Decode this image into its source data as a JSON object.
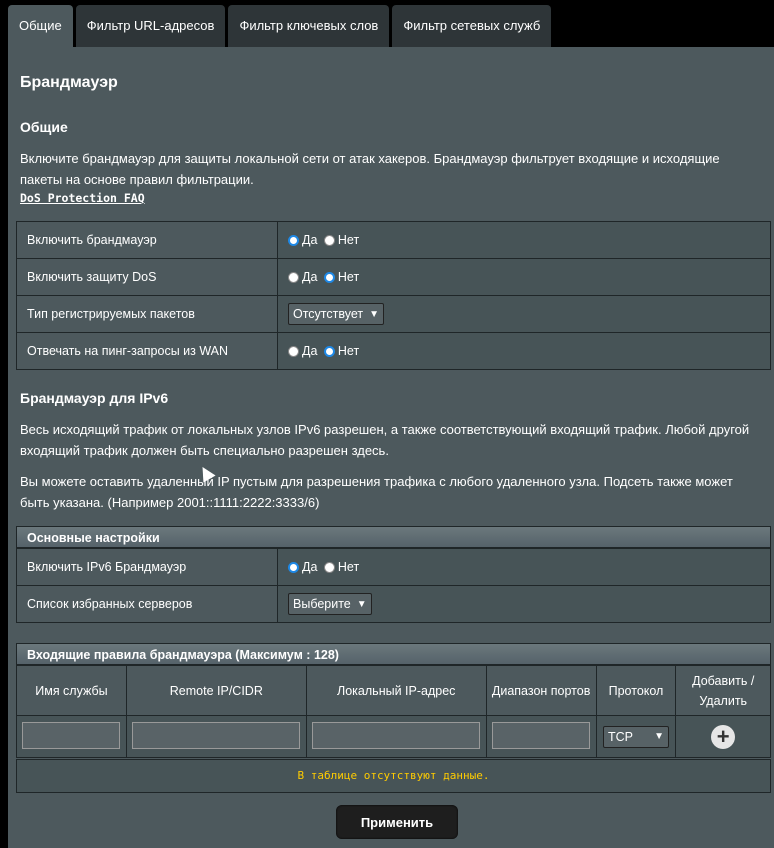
{
  "tabs": [
    "Общие",
    "Фильтр URL-адресов",
    "Фильтр ключевых слов",
    "Фильтр сетевых служб"
  ],
  "header": {
    "title": "Брандмауэр"
  },
  "general": {
    "title": "Общие",
    "description": "Включите брандмауэр для защиты локальной сети от атак хакеров. Брандмауэр фильтрует входящие и исходящие пакеты на основе правил фильтрации.",
    "faq_link": "DoS Protection FAQ"
  },
  "settings": [
    {
      "label": "Включить брандмауэр",
      "yes": "Да",
      "no": "Нет",
      "selected": "yes"
    },
    {
      "label": "Включить защиту DoS",
      "yes": "Да",
      "no": "Нет",
      "selected": "no"
    },
    {
      "label": "Тип регистрируемых пакетов",
      "select": "Отсутствует"
    },
    {
      "label": "Отвечать на пинг-запросы из WAN",
      "yes": "Да",
      "no": "Нет",
      "selected": "no"
    }
  ],
  "ipv6": {
    "title": "Брандмауэр для IPv6",
    "para1": "Весь исходящий трафик от локальных узлов IPv6 разрешен, а также соответствующий входящий трафик. Любой другой входящий трафик должен быть специально разрешен здесь.",
    "para2": "Вы можете оставить удаленный IP пустым для разрешения трафика с любого удаленного узла. Подсеть также может быть указана. (Например 2001::1111:2222:3333/6)"
  },
  "basic": {
    "header": "Основные настройки",
    "enable_label": "Включить IPv6 Брандмауэр",
    "yes": "Да",
    "no": "Нет",
    "selected": "yes",
    "servers_label": "Список избранных серверов",
    "servers_select": "Выберите"
  },
  "rules": {
    "header": "Входящие правила брандмауэра (Максимум : 128)",
    "columns": [
      "Имя службы",
      "Remote IP/CIDR",
      "Локальный IP-адрес",
      "Диапазон портов",
      "Протокол",
      "Добавить / Удалить"
    ],
    "protocol": "TCP",
    "empty_text": "В таблице отсутствуют данные."
  },
  "apply_label": "Применить"
}
